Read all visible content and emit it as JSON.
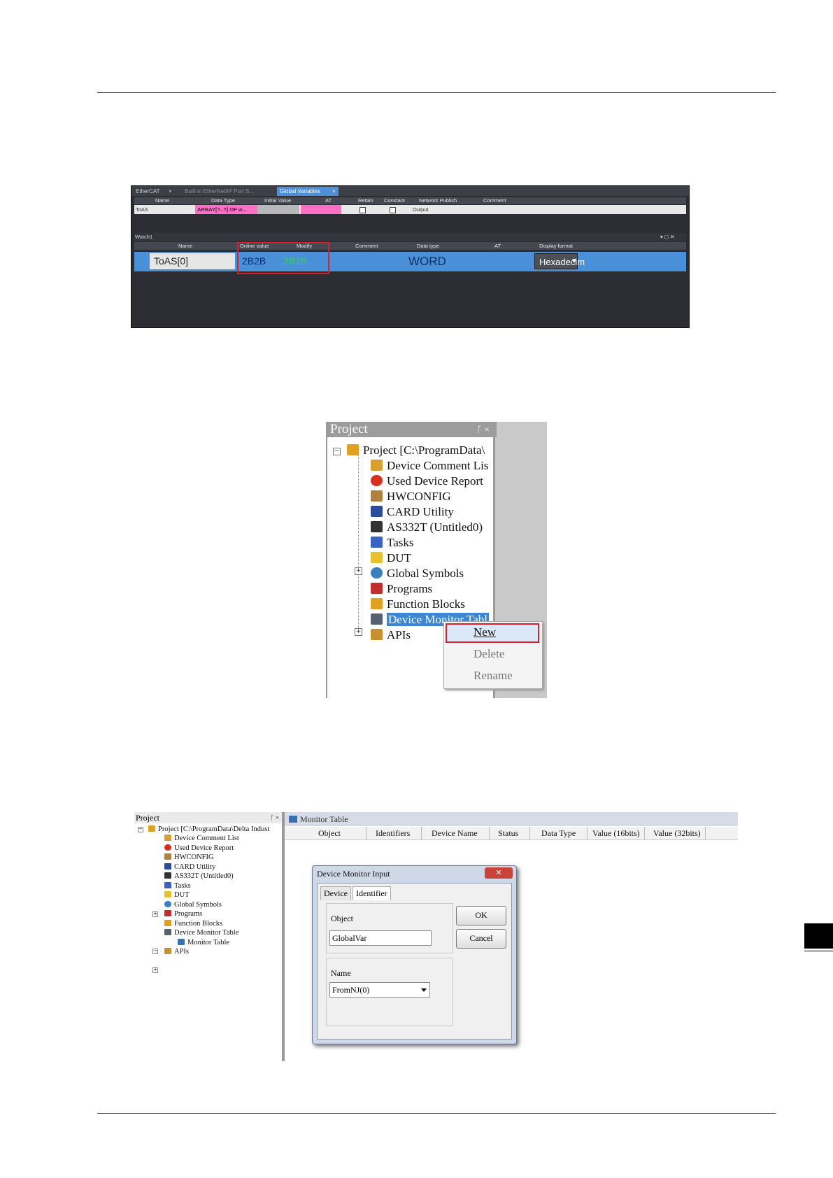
{
  "screenshot1": {
    "tabs": [
      "EtherCAT",
      "Built-in EtherNet/IP Port S...",
      "Global Variables"
    ],
    "gv_headers": [
      "Name",
      "Data Type",
      "Initial Value",
      "AT",
      "Retain",
      "Constant",
      "Network Publish",
      "Comment"
    ],
    "gv_row": {
      "name": "ToAS",
      "data_type": "ARRAY[?..?] OF w...",
      "network_publish": "Output"
    },
    "watch_title": "Watch1",
    "watch_title_icons": "▾ ◻ ✕",
    "watch_headers": [
      "Name",
      "Online value",
      "Modify",
      "Comment",
      "Data type",
      "AT",
      "Display format"
    ],
    "watch_row": {
      "name": "ToAS[0]",
      "online_value": "2B2B",
      "modify": "2B2B",
      "data_type": "WORD",
      "display_format": "Hexadecim"
    }
  },
  "screenshot2": {
    "panel_title": "Project",
    "panel_icons": "ᚴ ×",
    "tree": [
      {
        "label": "Project [C:\\ProgramData\\",
        "icon": "project-icon",
        "color": "#e0a020"
      },
      {
        "label": "Device Comment Lis",
        "icon": "comment-icon",
        "color": "#d8a030"
      },
      {
        "label": "Used Device Report",
        "icon": "report-icon",
        "color": "#d83020"
      },
      {
        "label": "HWCONFIG",
        "icon": "hwconfig-icon",
        "color": "#b08040"
      },
      {
        "label": "CARD Utility",
        "icon": "card-icon",
        "color": "#2a4c9a"
      },
      {
        "label": "AS332T  (Untitled0)",
        "icon": "plc-icon",
        "color": "#333333"
      },
      {
        "label": "Tasks",
        "icon": "tasks-icon",
        "color": "#3a62c0"
      },
      {
        "label": "DUT",
        "icon": "dut-icon",
        "color": "#e8c030"
      },
      {
        "label": "Global Symbols",
        "icon": "globe-icon",
        "color": "#3a7fc0"
      },
      {
        "label": "Programs",
        "icon": "programs-icon",
        "color": "#c03030"
      },
      {
        "label": "Function Blocks",
        "icon": "function-blocks-icon",
        "color": "#e0a020"
      },
      {
        "label": "Device Monitor Tabl",
        "icon": "monitor-icon",
        "color": "#556070"
      },
      {
        "label": "APIs",
        "icon": "api-icon",
        "color": "#c89030"
      }
    ],
    "menu": {
      "new": "New",
      "delete": "Delete",
      "rename": "Rename"
    }
  },
  "screenshot3": {
    "panel_title": "Project",
    "panel_icons": "ᚴ ×",
    "tree": [
      "Project [C:\\ProgramData\\Delta Indust",
      "Device Comment List",
      "Used Device Report",
      "HWCONFIG",
      "CARD Utility",
      "AS332T  (Untitled0)",
      "Tasks",
      "DUT",
      "Global Symbols",
      "Programs",
      "Function Blocks",
      "Device Monitor Table",
      "Monitor Table",
      "APIs"
    ],
    "monitor_title": "Monitor Table",
    "columns": [
      "Object",
      "Identifiers",
      "Device Name",
      "Status",
      "Data Type",
      "Value (16bits)",
      "Value (32bits)"
    ],
    "dialog": {
      "title": "Device Monitor Input",
      "close": "✕",
      "tab_device": "Device",
      "tab_identifier": "Identifier",
      "object_label": "Object",
      "object_value": "GlobalVar",
      "name_label": "Name",
      "name_value": "FromNJ(0)",
      "ok": "OK",
      "cancel": "Cancel"
    }
  }
}
